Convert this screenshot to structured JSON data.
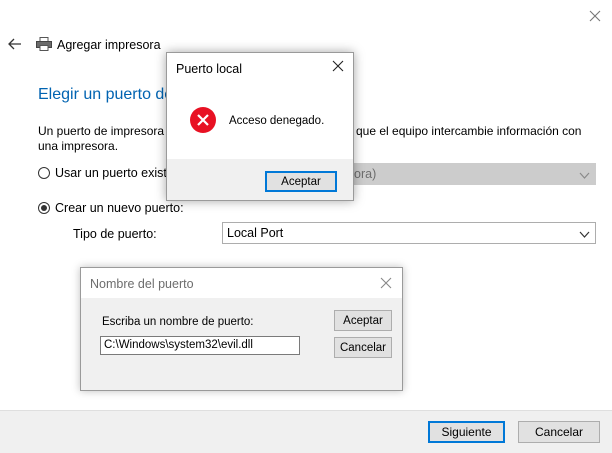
{
  "wizard": {
    "title": "Agregar impresora",
    "heading": "Elegir un puerto de",
    "description_line1": "Un puerto de impresora",
    "description_line1_tail": "que el equipo intercambie información con",
    "description_line2": "una impresora.",
    "option_existing_label": "Usar un puerto existe",
    "option_existing_value_tail": "ora)",
    "option_new_label": "Crear un nuevo puerto:",
    "port_type_label": "Tipo de puerto:",
    "port_type_value": "Local Port",
    "next_button": "Siguiente",
    "cancel_button": "Cancelar"
  },
  "port_name_dialog": {
    "title": "Nombre del puerto",
    "prompt": "Escriba un nombre de puerto:",
    "input_value": "C:\\Windows\\system32\\evil.dll",
    "ok_button": "Aceptar",
    "cancel_button": "Cancelar"
  },
  "error_dialog": {
    "title": "Puerto local",
    "message": "Acceso denegado.",
    "ok_button": "Aceptar",
    "icon": "error-icon",
    "icon_color": "#e81123"
  },
  "icons": {
    "back": "back-arrow-icon",
    "printer": "printer-icon",
    "close": "close-icon",
    "chevron": "chevron-down-icon"
  },
  "colors": {
    "heading": "#0063b1",
    "primary_border": "#0078d7",
    "footer_bg": "#f0f0f0"
  }
}
